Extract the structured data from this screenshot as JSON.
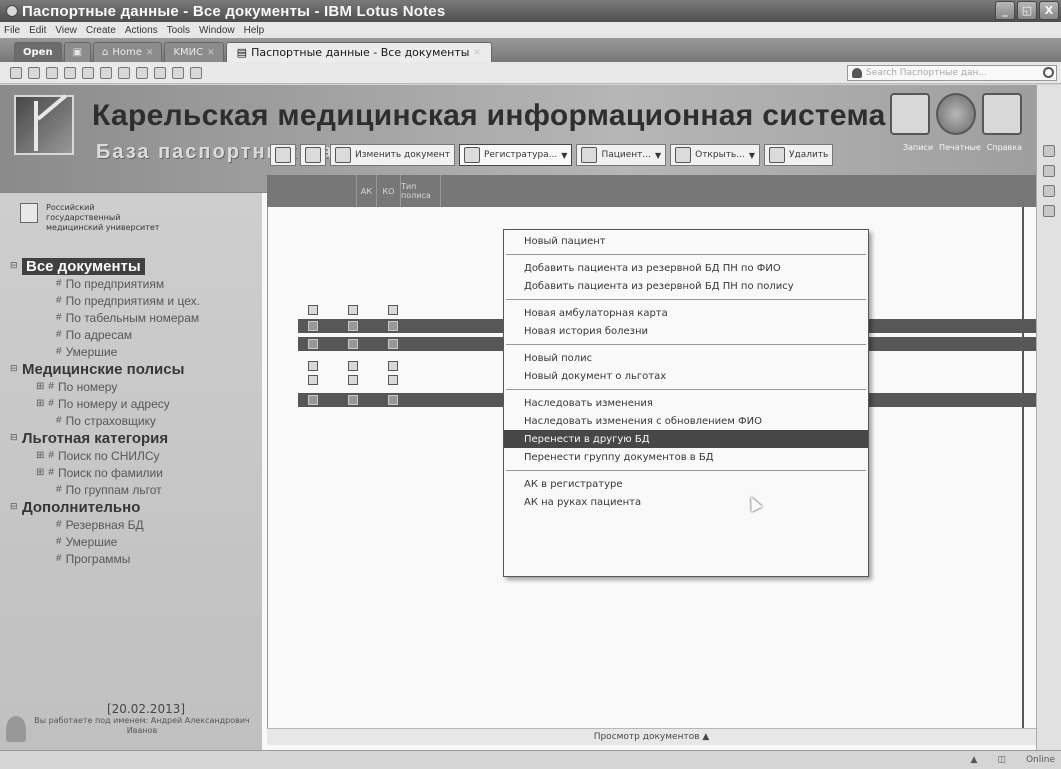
{
  "window": {
    "title": "Паспортные данные - Все документы - IBM Lotus Notes",
    "buttons": [
      "_",
      "◱",
      "X"
    ]
  },
  "menu": [
    "File",
    "Edit",
    "View",
    "Create",
    "Actions",
    "Tools",
    "Window",
    "Help"
  ],
  "tabs": {
    "open": "Open",
    "home": "Home",
    "kmis": "KMИС",
    "active": "Паспортные данные - Все документы"
  },
  "search": {
    "placeholder": "Search Паспортные дан..."
  },
  "banner": {
    "title": "Карельская медицинская информационная система",
    "subtitle": "База паспортных данных",
    "icon_labels": [
      "Записи",
      "Печатные",
      "Справка"
    ]
  },
  "university": "Российский государственный медицинский университет",
  "nav": {
    "all_docs": "Все документы",
    "all_docs_items": [
      "По предприятиям",
      "По предприятиям и цех.",
      "По табельным номерам",
      "По адресам",
      "Умершие"
    ],
    "policies": "Медицинские полисы",
    "policies_items": [
      "По номеру",
      "По номеру и адресу",
      "По страховщику"
    ],
    "benefit": "Льготная категория",
    "benefit_items": [
      "Поиск по СНИЛСу",
      "Поиск по фамилии",
      "По группам льгот"
    ],
    "extra": "Дополнительно",
    "extra_items": [
      "Резервная БД",
      "Умершие",
      "Программы"
    ]
  },
  "footer": {
    "date": "[20.02.2013]",
    "worker": "Вы работаете под именем: Андрей Александрович Иванов"
  },
  "actions": {
    "edit": "Изменить документ",
    "registry": "Регистратура...",
    "patient": "Пациент...",
    "open": "Открыть...",
    "delete": "Удалить"
  },
  "grid": {
    "cols": [
      "",
      "АК",
      "КО",
      "Тип полиса"
    ]
  },
  "dropdown": {
    "groups": [
      [
        "Новый пациент"
      ],
      [
        "Добавить пациента из резервной БД ПН по ФИО",
        "Добавить пациента из резервной БД ПН по полису"
      ],
      [
        "Новая амбулаторная карта",
        "Новая история болезни"
      ],
      [
        "Новый полис",
        "Новый документ о льготах"
      ],
      [
        "Наследовать изменения",
        "Наследовать изменения с обновлением ФИО",
        "Перенести в другую БД",
        "Перенести группу документов в БД"
      ],
      [
        "АК в регистратуре",
        "АК на руках пациента"
      ]
    ],
    "highlighted": "Перенести в другую БД"
  },
  "status_footer": "Просмотр документов ▲",
  "statusbar": {
    "online": "Online"
  }
}
